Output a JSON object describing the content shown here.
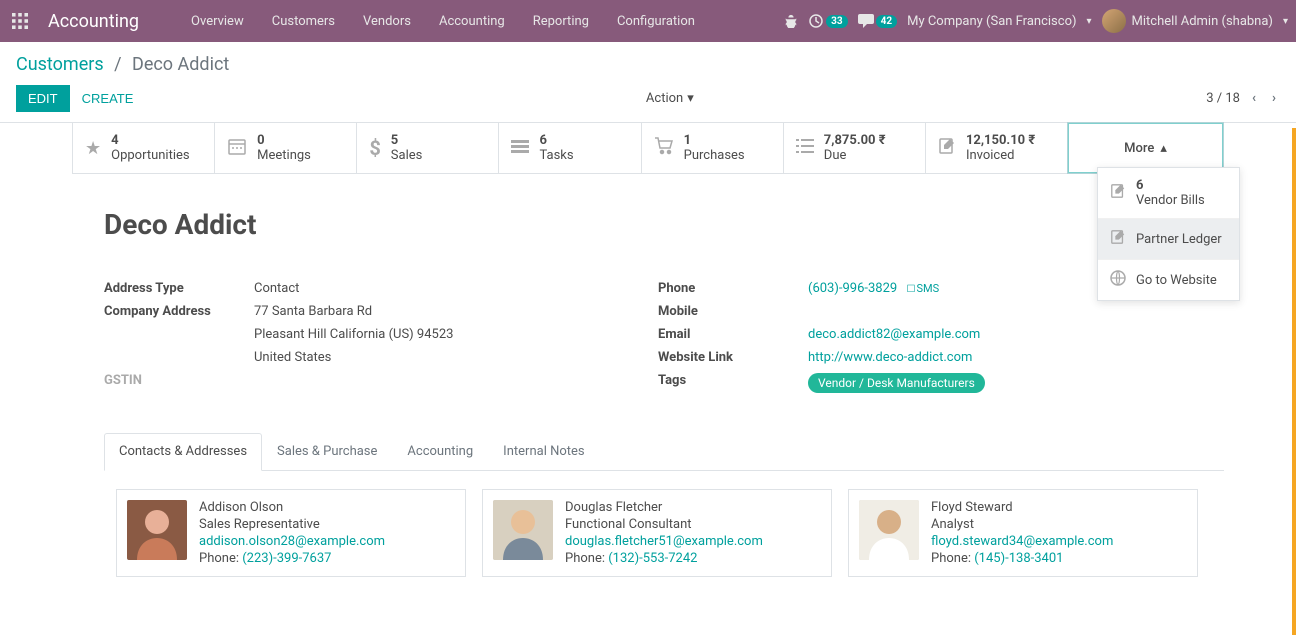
{
  "navbar": {
    "brand": "Accounting",
    "links": [
      "Overview",
      "Customers",
      "Vendors",
      "Accounting",
      "Reporting",
      "Configuration"
    ],
    "badge1": "33",
    "badge2": "42",
    "company": "My Company (San Francisco)",
    "user": "Mitchell Admin (shabna)"
  },
  "breadcrumb": {
    "root": "Customers",
    "current": "Deco Addict"
  },
  "controls": {
    "edit": "EDIT",
    "create": "CREATE",
    "action": "Action",
    "pager": "3 / 18"
  },
  "stats": [
    {
      "icon": "star",
      "num": "4",
      "label": "Opportunities"
    },
    {
      "icon": "calendar",
      "num": "0",
      "label": "Meetings"
    },
    {
      "icon": "dollar",
      "num": "5",
      "label": "Sales"
    },
    {
      "icon": "tasks",
      "num": "6",
      "label": "Tasks"
    },
    {
      "icon": "cart",
      "num": "1",
      "label": "Purchases"
    },
    {
      "icon": "list",
      "num": "7,875.00 ₹",
      "label": "Due"
    },
    {
      "icon": "edit",
      "num": "12,150.10 ₹",
      "label": "Invoiced"
    }
  ],
  "more_label": "More",
  "more_items": [
    {
      "icon": "edit",
      "num": "6",
      "label": "Vendor Bills"
    },
    {
      "icon": "edit",
      "num": "",
      "label": "Partner Ledger",
      "active": true
    },
    {
      "icon": "globe",
      "num": "",
      "label": "Go to Website"
    }
  ],
  "title": "Deco Addict",
  "left_fields": {
    "addr_type_label": "Address Type",
    "addr_type": "Contact",
    "company_addr_label": "Company Address",
    "street": "77 Santa Barbara Rd",
    "city_line": "Pleasant Hill  California (US)  94523",
    "country": "United States",
    "gstin_label": "GSTIN"
  },
  "right_fields": {
    "phone_label": "Phone",
    "phone": "(603)-996-3829",
    "sms": "SMS",
    "mobile_label": "Mobile",
    "email_label": "Email",
    "email": "deco.addict82@example.com",
    "website_label": "Website Link",
    "website": "http://www.deco-addict.com",
    "tags_label": "Tags",
    "tag": "Vendor / Desk Manufacturers"
  },
  "tabs": [
    "Contacts & Addresses",
    "Sales & Purchase",
    "Accounting",
    "Internal Notes"
  ],
  "contacts": [
    {
      "name": "Addison Olson",
      "role": "Sales Representative",
      "email": "addison.olson28@example.com",
      "phone_label": "Phone: ",
      "phone": "(223)-399-7637"
    },
    {
      "name": "Douglas Fletcher",
      "role": "Functional Consultant",
      "email": "douglas.fletcher51@example.com",
      "phone_label": "Phone: ",
      "phone": "(132)-553-7242"
    },
    {
      "name": "Floyd Steward",
      "role": "Analyst",
      "email": "floyd.steward34@example.com",
      "phone_label": "Phone: ",
      "phone": "(145)-138-3401"
    }
  ]
}
